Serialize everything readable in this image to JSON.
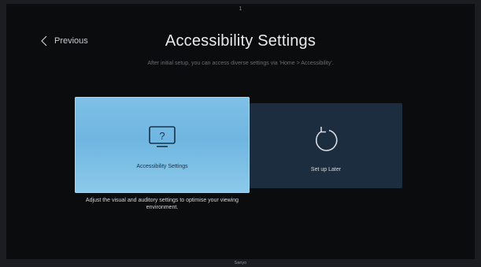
{
  "step_indicator": "1",
  "header": {
    "back_label": "Previous",
    "title": "Accessibility Settings",
    "subtitle": "After initial setup, you can access diverse settings via 'Home > Accessibility'."
  },
  "options": [
    {
      "label": "Accessibility Settings",
      "icon": "monitor-question-icon",
      "description": "Adjust the visual and auditory settings to optimise your viewing environment.",
      "selected": true
    },
    {
      "label": "Set up Later",
      "icon": "refresh-icon",
      "selected": false
    }
  ],
  "brand": "Sanyo",
  "colors": {
    "selected_tile": "#7fc0e6",
    "unselected_tile": "#1d2d40",
    "background": "#0b0c0e"
  }
}
